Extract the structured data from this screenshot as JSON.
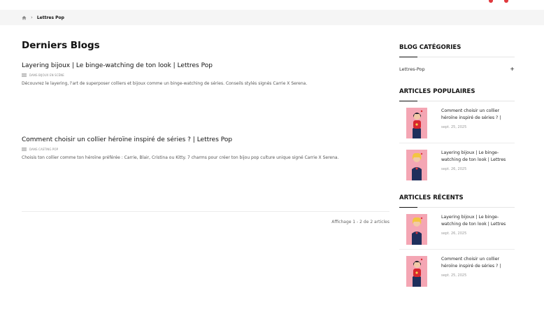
{
  "breadcrumb": {
    "current": "Lettres Pop"
  },
  "main": {
    "title": "Derniers Blogs",
    "posts": [
      {
        "title": "Layering bijoux | Le binge-watching de ton look | Lettres Pop",
        "category": "DANS BIJOUX EN SCÈNE",
        "excerpt": "Découvrez le layering, l'art de superposer colliers et bijoux comme un binge-watching de séries. Conseils stylés signés Carrie X Serena."
      },
      {
        "title": "Comment choisir un collier héroïne inspiré de séries ? | Lettres Pop",
        "category": "DANS CASTING POP",
        "excerpt": "Choisis ton collier comme ton héroïne préférée : Carrie, Blair, Cristina ou Kitty. 7 charms pour créer ton bijou pop culture unique signé Carrie X Serena."
      }
    ],
    "pagination": "Affichage 1 - 2 de 2 articles"
  },
  "sidebar": {
    "categories_heading": "BLOG CATÉGORIES",
    "categories": [
      {
        "label": "Lettres-Pop"
      }
    ],
    "popular_heading": "ARTICLES POPULAIRES",
    "popular": [
      {
        "title": "Comment choisir un collier héroïne inspiré de séries ? |",
        "date": "sept. 25, 2025",
        "thumb": "red"
      },
      {
        "title": "Layering bijoux | Le binge-watching de ton look | Lettres",
        "date": "sept. 26, 2025",
        "thumb": "blonde"
      }
    ],
    "recent_heading": "ARTICLES RÉCENTS",
    "recent": [
      {
        "title": "Layering bijoux | Le binge-watching de ton look | Lettres",
        "date": "sept. 26, 2025",
        "thumb": "blonde"
      },
      {
        "title": "Comment choisir un collier héroïne inspiré de séries ? |",
        "date": "sept. 25, 2025",
        "thumb": "red"
      }
    ]
  },
  "colors": {
    "accent": "#e0393e",
    "thumb_bg": "#f4a6b4",
    "breadcrumb_bg": "#f5f5f5"
  },
  "icons": {
    "home": "home-icon",
    "breadcrumb_separator": "chevron-right-icon",
    "category": "folder-icon",
    "expand": "plus-icon"
  }
}
